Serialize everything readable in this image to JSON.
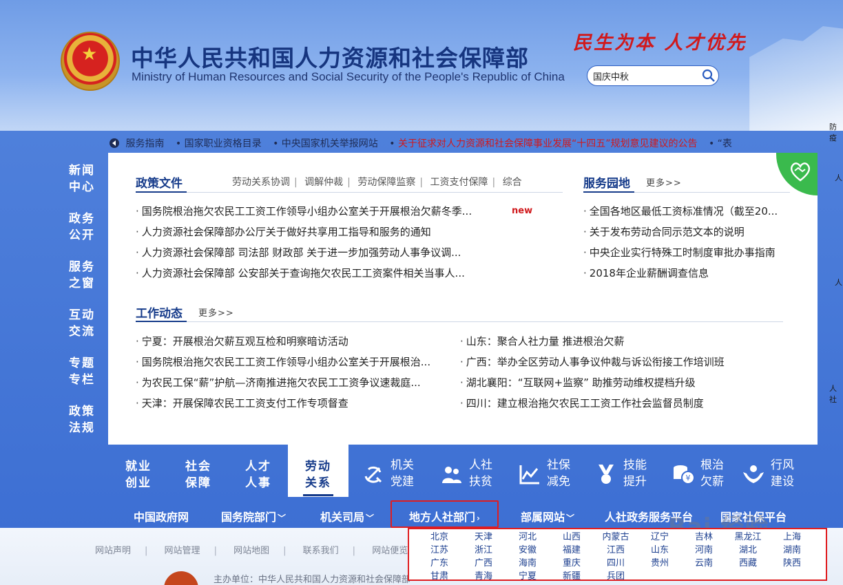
{
  "header": {
    "title_cn": "中华人民共和国人力资源和社会保障部",
    "title_en": "Ministry of Human Resources and Social Security of the People's Republic of China",
    "slogan": "民生为本 人才优先",
    "search": {
      "value": "国庆中秋",
      "placeholder": ""
    }
  },
  "ticker": {
    "items": [
      "服务指南",
      "国家职业资格目录",
      "中央国家机关举报网站"
    ],
    "hot_item": "关于征求对人力资源和社会保障事业发展“十四五”规划意见建议的公告",
    "tail": "“表"
  },
  "right_edge": [
    "防疫",
    "人",
    "人",
    "人社"
  ],
  "left_nav": [
    {
      "line1": "新闻",
      "line2": "中心"
    },
    {
      "line1": "政务",
      "line2": "公开"
    },
    {
      "line1": "服务",
      "line2": "之窗"
    },
    {
      "line1": "互动",
      "line2": "交流"
    },
    {
      "line1": "专题",
      "line2": "专栏"
    },
    {
      "line1": "政策",
      "line2": "法规"
    }
  ],
  "policy": {
    "heading": "政策文件",
    "tabs": [
      "劳动关系协调",
      "调解仲裁",
      "劳动保障监察",
      "工资支付保障",
      "综合"
    ],
    "new_tag": "new",
    "items": [
      "国务院根治拖欠农民工工资工作领导小组办公室关于开展根治欠薪冬季...",
      "人力资源社会保障部办公厅关于做好共享用工指导和服务的通知",
      "人力资源社会保障部 司法部 财政部 关于进一步加强劳动人事争议调...",
      "人力资源社会保障部 公安部关于查询拖欠农民工工资案件相关当事人..."
    ]
  },
  "service": {
    "heading": "服务园地",
    "more": "更多>>",
    "items": [
      "全国各地区最低工资标准情况（截至20...",
      "关于发布劳动合同示范文本的说明",
      "中央企业实行特殊工时制度审批办事指南",
      "2018年企业薪酬调查信息"
    ]
  },
  "news": {
    "heading": "工作动态",
    "more": "更多>>",
    "left_items": [
      "宁夏：开展根治欠薪互观互检和明察暗访活动",
      "国务院根治拖欠农民工工资工作领导小组办公室关于开展根治...",
      "为农民工保“薪”护航—济南推进拖欠农民工工资争议速裁庭...",
      "天津：开展保障农民工工资支付工作专项督查"
    ],
    "right_items": [
      "山东：聚合人社力量 推进根治欠薪",
      "广西：举办全区劳动人事争议仲裁与诉讼衔接工作培训班",
      "湖北襄阳：“互联网+监察” 助推劳动维权提档升级",
      "四川：建立根治拖欠农民工工资工作社会监督员制度"
    ]
  },
  "categories": {
    "tabs": [
      {
        "line1": "就业",
        "line2": "创业"
      },
      {
        "line1": "社会",
        "line2": "保障"
      },
      {
        "line1": "人才",
        "line2": "人事"
      },
      {
        "line1": "劳动",
        "line2": "关系"
      }
    ],
    "icon_items": [
      {
        "line1": "机关",
        "line2": "党建",
        "icon": "party-emblem-icon"
      },
      {
        "line1": "人社",
        "line2": "扶贫",
        "icon": "people-icon"
      },
      {
        "line1": "社保",
        "line2": "减免",
        "icon": "chart-icon"
      },
      {
        "line1": "技能",
        "line2": "提升",
        "icon": "medal-icon"
      },
      {
        "line1": "根治",
        "line2": "欠薪",
        "icon": "coins-icon"
      },
      {
        "line1": "行风",
        "line2": "建设",
        "icon": "hands-icon"
      }
    ]
  },
  "bottom_nav": [
    {
      "label": "中国政府网",
      "chev": ""
    },
    {
      "label": "国务院部门",
      "chev": "﹀"
    },
    {
      "label": "机关司局",
      "chev": "﹀"
    },
    {
      "label": "地方人社部门",
      "chev": "›"
    },
    {
      "label": "部属网站",
      "chev": "﹀"
    },
    {
      "label": "人社政务服务平台",
      "chev": ""
    },
    {
      "label": "国家社保平台",
      "chev": ""
    }
  ],
  "regions": [
    [
      "北京",
      "天津",
      "河北",
      "山西",
      "内蒙古",
      "辽宁",
      "吉林",
      "黑龙江",
      "上海"
    ],
    [
      "江苏",
      "浙江",
      "安徽",
      "福建",
      "江西",
      "山东",
      "河南",
      "湖北",
      "湖南"
    ],
    [
      "广东",
      "广西",
      "海南",
      "重庆",
      "四川",
      "贵州",
      "云南",
      "西藏",
      "陕西"
    ],
    [
      "甘肃",
      "青海",
      "宁夏",
      "新疆",
      "兵团"
    ]
  ],
  "footer": {
    "links": [
      "网站声明",
      "网站管理",
      "网站地图",
      "联系我们",
      "网站便览"
    ],
    "host": "主办单位：中华人民共和国人力资源和社会保障部"
  },
  "watermark": "Bai 经验",
  "colors": {
    "brand_blue": "#163b8a",
    "accent_red": "#d0191c",
    "badge_green": "#3aba4d"
  }
}
